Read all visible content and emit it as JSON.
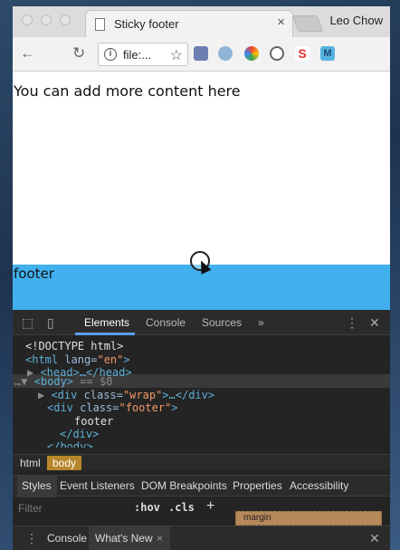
{
  "browser": {
    "tab_title": "Sticky footer",
    "tab_close": "×",
    "profile_name": "Leo Chow",
    "url_text": "file:...",
    "back_icon": "←",
    "reload_icon": "↻",
    "star_icon": "☆",
    "extensions": [
      "ext-icon-1",
      "ext-icon-2",
      "ext-icon-3",
      "ext-icon-4",
      "ext-icon-5",
      "ext-icon-6"
    ]
  },
  "page": {
    "content_text": "You can add more content here",
    "footer_text": "footer",
    "footer_color": "#42b0ee"
  },
  "devtools": {
    "tabs": [
      "Elements",
      "Console",
      "Sources",
      "»"
    ],
    "active_tab": "Elements",
    "dom": {
      "doctype": "<!DOCTYPE html>",
      "html_tag": "<html",
      "html_attr": " lang=",
      "html_val": "\"en\"",
      "html_close": ">",
      "head": "<head>…</head>",
      "body_dots": "…",
      "body_tag": "<body>",
      "body_eq": " == $0",
      "wrap_open": "<div",
      "wrap_attr": " class=",
      "wrap_val": "\"wrap\"",
      "wrap_close": ">…</div>",
      "footer_open": "<div",
      "footer_attr": " class=",
      "footer_val": "\"footer\"",
      "footer_close": ">",
      "footer_text": "footer",
      "div_close": "</div>",
      "more": "</body>"
    },
    "breadcrumbs": [
      "html",
      "body"
    ],
    "styles_tabs": [
      "Styles",
      "Event Listeners",
      "DOM Breakpoints",
      "Properties",
      "Accessibility"
    ],
    "filter_placeholder": "Filter",
    "hov": ":hov",
    "cls": ".cls",
    "plus": "+",
    "margin_label": "margin",
    "drawer_tabs": [
      "Console",
      "What's New"
    ],
    "drawer_close": "×",
    "close_icon": "✕"
  }
}
